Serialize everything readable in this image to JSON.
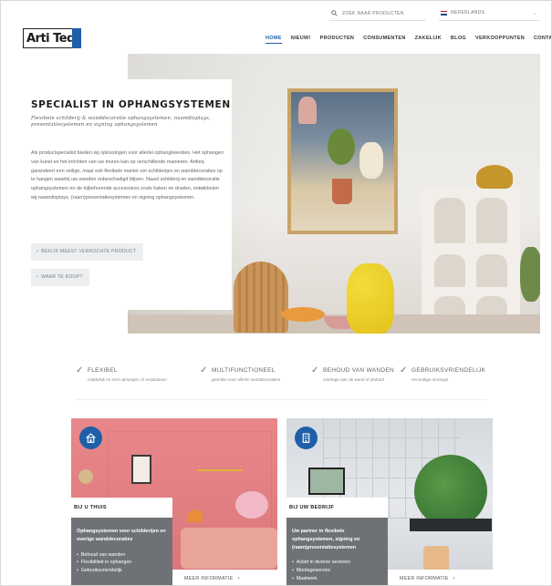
{
  "colors": {
    "brand_blue": "#1f5fa8",
    "panel_grey": "#6e7277",
    "button_bg": "#eceef0"
  },
  "topbar": {
    "search_placeholder": "ZOEK NAAR PRODUCTEN",
    "search_icon": "search-icon",
    "language": "NEDERLANDS",
    "language_flag": "flag-netherlands-icon"
  },
  "logo": {
    "text": "Arti Teq"
  },
  "nav": {
    "items": [
      {
        "label": "HOME",
        "active": true
      },
      {
        "label": "NIEUW!"
      },
      {
        "label": "PRODUCTEN"
      },
      {
        "label": "CONSUMENTEN"
      },
      {
        "label": "ZAKELIJK"
      },
      {
        "label": "BLOG"
      },
      {
        "label": "VERKOOPPUNTEN"
      },
      {
        "label": "CONTACT"
      }
    ]
  },
  "hero": {
    "title": "SPECIALIST IN OPHANGSYSTEMEN",
    "tagline": "Flexibele schilderij & wanddecoratie ophangsystemen, naamdisplays, presentatiesystemen en signing ophangsystemen",
    "body": "Als productspecialist bieden wij oplossingen voor allerlei ophangkwesties. Het ophangen van kunst en het inrichten van uw muren kan op verschillende manieren. Artiteq garandeert een veilige, maar ook flexibele manier om schilderijen en wanddecoraties op te hangen waarbij uw wanden onbeschadigd blijven. Naast schilderij en wanddecoratie ophangsystemen en de bijbehorende accessoires zoals haken en draden, ontwikkelen wij naamdisplays, (raam)presentatiesystemen en signing ophangsystemen.",
    "button_1": "BEKIJK MEEST VERKOCHTE PRODUCT",
    "button_2": "WAAR TE KOOP?"
  },
  "features": [
    {
      "title": "FLEXIBEL",
      "subtitle": "makkelijk en snel ophangen of verplaatsen"
    },
    {
      "title": "MULTIFUNCTIONEEL",
      "subtitle": "geschikt voor allerlei wanddecoraties"
    },
    {
      "title": "BEHOUD VAN WANDEN",
      "subtitle": "montage aan de wand of plafond"
    },
    {
      "title": "GEBRUIKSVRIENDELIJK",
      "subtitle": "eenmalige montage"
    }
  ],
  "cards": [
    {
      "icon": "home-icon",
      "title": "BIJ U THUIS",
      "body": "Ophangsystemen voor schilderijen en overige wanddecoraties",
      "bullets": [
        "Behoud van wanden",
        "Flexibiliteit in ophangen",
        "Gebruiksvriendelijk"
      ],
      "more": "MEER INFORMATIE"
    },
    {
      "icon": "office-building-icon",
      "title": "BIJ UW BEDRIJF",
      "body": "Uw partner in flexibele ophangsystemen, signing en (raam)presentatiesystemen",
      "bullets": [
        "Actief in diverse sectoren",
        "Montageservice",
        "Maatwerk"
      ],
      "more": "MEER INFORMATIE"
    }
  ]
}
